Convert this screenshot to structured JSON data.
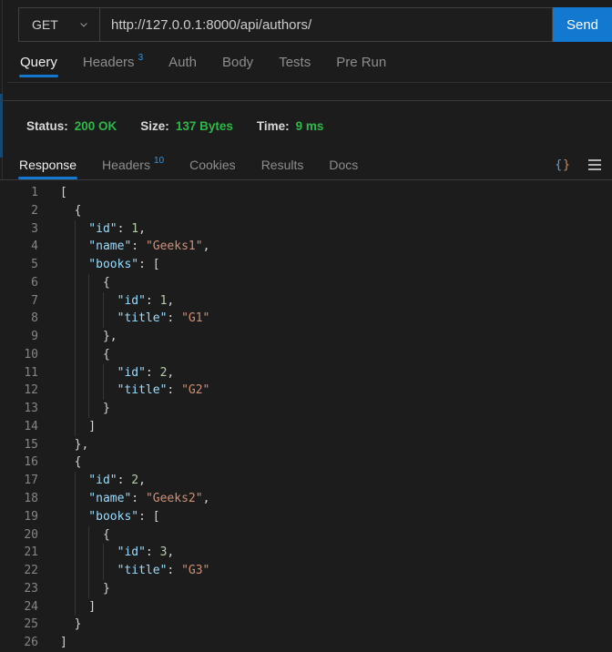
{
  "colors": {
    "accent_blue": "#1378cf",
    "badge_blue": "#2d9af0",
    "success_green": "#2db84a",
    "key": "#9cdcfe",
    "string": "#ce9178",
    "number": "#b5cea8",
    "punctuation": "#d4d4d4"
  },
  "request_bar": {
    "method": "GET",
    "url": "http://127.0.0.1:8000/api/authors/",
    "send_label": "Send"
  },
  "request_tabs": [
    {
      "label": "Query",
      "active": true
    },
    {
      "label": "Headers",
      "badge": "3"
    },
    {
      "label": "Auth"
    },
    {
      "label": "Body"
    },
    {
      "label": "Tests"
    },
    {
      "label": "Pre Run"
    }
  ],
  "status_bar": [
    {
      "label": "Status:",
      "value": "200 OK"
    },
    {
      "label": "Size:",
      "value": "137 Bytes"
    },
    {
      "label": "Time:",
      "value": "9 ms"
    }
  ],
  "response_tabs": [
    {
      "label": "Response",
      "active": true
    },
    {
      "label": "Headers",
      "badge": "10"
    },
    {
      "label": "Cookies"
    },
    {
      "label": "Results"
    },
    {
      "label": "Docs"
    }
  ],
  "response_toolbar": {
    "format_icon_open": "{",
    "format_icon_close": "}"
  },
  "editor": {
    "lines": [
      {
        "n": "1",
        "tokens": [
          [
            "pun",
            "["
          ]
        ]
      },
      {
        "n": "2",
        "tokens": [
          [
            "pun",
            "  {"
          ]
        ]
      },
      {
        "n": "3",
        "tokens": [
          [
            "key",
            "    \"id\""
          ],
          [
            "pun",
            ": "
          ],
          [
            "num",
            "1"
          ],
          [
            "pun",
            ","
          ]
        ]
      },
      {
        "n": "4",
        "tokens": [
          [
            "key",
            "    \"name\""
          ],
          [
            "pun",
            ": "
          ],
          [
            "str",
            "\"Geeks1\""
          ],
          [
            "pun",
            ","
          ]
        ]
      },
      {
        "n": "5",
        "tokens": [
          [
            "key",
            "    \"books\""
          ],
          [
            "pun",
            ": ["
          ]
        ]
      },
      {
        "n": "6",
        "tokens": [
          [
            "pun",
            "      {"
          ]
        ]
      },
      {
        "n": "7",
        "tokens": [
          [
            "key",
            "        \"id\""
          ],
          [
            "pun",
            ": "
          ],
          [
            "num",
            "1"
          ],
          [
            "pun",
            ","
          ]
        ]
      },
      {
        "n": "8",
        "tokens": [
          [
            "key",
            "        \"title\""
          ],
          [
            "pun",
            ": "
          ],
          [
            "str",
            "\"G1\""
          ]
        ]
      },
      {
        "n": "9",
        "tokens": [
          [
            "pun",
            "      },"
          ]
        ]
      },
      {
        "n": "10",
        "tokens": [
          [
            "pun",
            "      {"
          ]
        ]
      },
      {
        "n": "11",
        "tokens": [
          [
            "key",
            "        \"id\""
          ],
          [
            "pun",
            ": "
          ],
          [
            "num",
            "2"
          ],
          [
            "pun",
            ","
          ]
        ]
      },
      {
        "n": "12",
        "tokens": [
          [
            "key",
            "        \"title\""
          ],
          [
            "pun",
            ": "
          ],
          [
            "str",
            "\"G2\""
          ]
        ]
      },
      {
        "n": "13",
        "tokens": [
          [
            "pun",
            "      }"
          ]
        ]
      },
      {
        "n": "14",
        "tokens": [
          [
            "pun",
            "    ]"
          ]
        ]
      },
      {
        "n": "15",
        "tokens": [
          [
            "pun",
            "  },"
          ]
        ]
      },
      {
        "n": "16",
        "tokens": [
          [
            "pun",
            "  {"
          ]
        ]
      },
      {
        "n": "17",
        "tokens": [
          [
            "key",
            "    \"id\""
          ],
          [
            "pun",
            ": "
          ],
          [
            "num",
            "2"
          ],
          [
            "pun",
            ","
          ]
        ]
      },
      {
        "n": "18",
        "tokens": [
          [
            "key",
            "    \"name\""
          ],
          [
            "pun",
            ": "
          ],
          [
            "str",
            "\"Geeks2\""
          ],
          [
            "pun",
            ","
          ]
        ]
      },
      {
        "n": "19",
        "tokens": [
          [
            "key",
            "    \"books\""
          ],
          [
            "pun",
            ": ["
          ]
        ]
      },
      {
        "n": "20",
        "tokens": [
          [
            "pun",
            "      {"
          ]
        ]
      },
      {
        "n": "21",
        "tokens": [
          [
            "key",
            "        \"id\""
          ],
          [
            "pun",
            ": "
          ],
          [
            "num",
            "3"
          ],
          [
            "pun",
            ","
          ]
        ]
      },
      {
        "n": "22",
        "tokens": [
          [
            "key",
            "        \"title\""
          ],
          [
            "pun",
            ": "
          ],
          [
            "str",
            "\"G3\""
          ]
        ]
      },
      {
        "n": "23",
        "tokens": [
          [
            "pun",
            "      }"
          ]
        ]
      },
      {
        "n": "24",
        "tokens": [
          [
            "pun",
            "    ]"
          ]
        ]
      },
      {
        "n": "25",
        "tokens": [
          [
            "pun",
            "  }"
          ]
        ]
      },
      {
        "n": "26",
        "tokens": [
          [
            "pun",
            "]"
          ]
        ]
      }
    ]
  }
}
